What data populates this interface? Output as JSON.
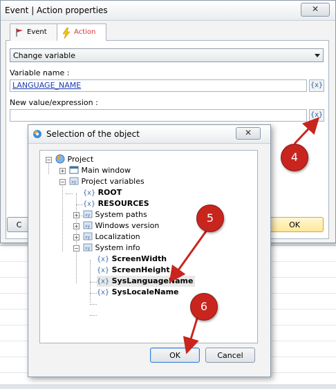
{
  "outer_dialog": {
    "title": "Event | Action properties",
    "close_glyph": "✕",
    "tabs": [
      {
        "label": "Event"
      },
      {
        "label": "Action"
      }
    ],
    "action_select": "Change variable",
    "variable_name_label": "Variable name :",
    "variable_name_value": "LANGUAGE_NAME",
    "new_value_label": "New value/expression :",
    "new_value_value": "",
    "var_button_label": "{x}",
    "ok_label": "OK",
    "cancel_stub_label": "C"
  },
  "inner_dialog": {
    "title": "Selection of the object",
    "close_glyph": "✕",
    "ok_label": "OK",
    "cancel_label": "Cancel",
    "tree": [
      {
        "label": "Project",
        "icon": "project-globe-icon"
      },
      {
        "label": "Main window",
        "icon": "window-icon"
      },
      {
        "label": "Project variables",
        "icon": "variables-folder-icon"
      },
      {
        "prefix": "{x}",
        "label": "ROOT",
        "icon": "variable-icon"
      },
      {
        "prefix": "{x}",
        "label": "RESOURCES",
        "icon": "variable-icon"
      },
      {
        "label": "System paths",
        "icon": "variables-folder-icon"
      },
      {
        "label": "Windows version",
        "icon": "variables-folder-icon"
      },
      {
        "label": "Localization",
        "icon": "variables-folder-icon"
      },
      {
        "label": "System info",
        "icon": "variables-folder-icon"
      },
      {
        "prefix": "{x}",
        "label": "ScreenWidth",
        "icon": "variable-icon"
      },
      {
        "prefix": "{x}",
        "label": "ScreenHeight",
        "icon": "variable-icon"
      },
      {
        "prefix": "{x}",
        "label": "SysLanguageName",
        "icon": "variable-icon"
      },
      {
        "prefix": "{x}",
        "label": "SysLocaleName",
        "icon": "variable-icon"
      }
    ]
  },
  "annotations": {
    "step4": "4",
    "step5": "5",
    "step6": "6",
    "color": "#c8251e"
  }
}
